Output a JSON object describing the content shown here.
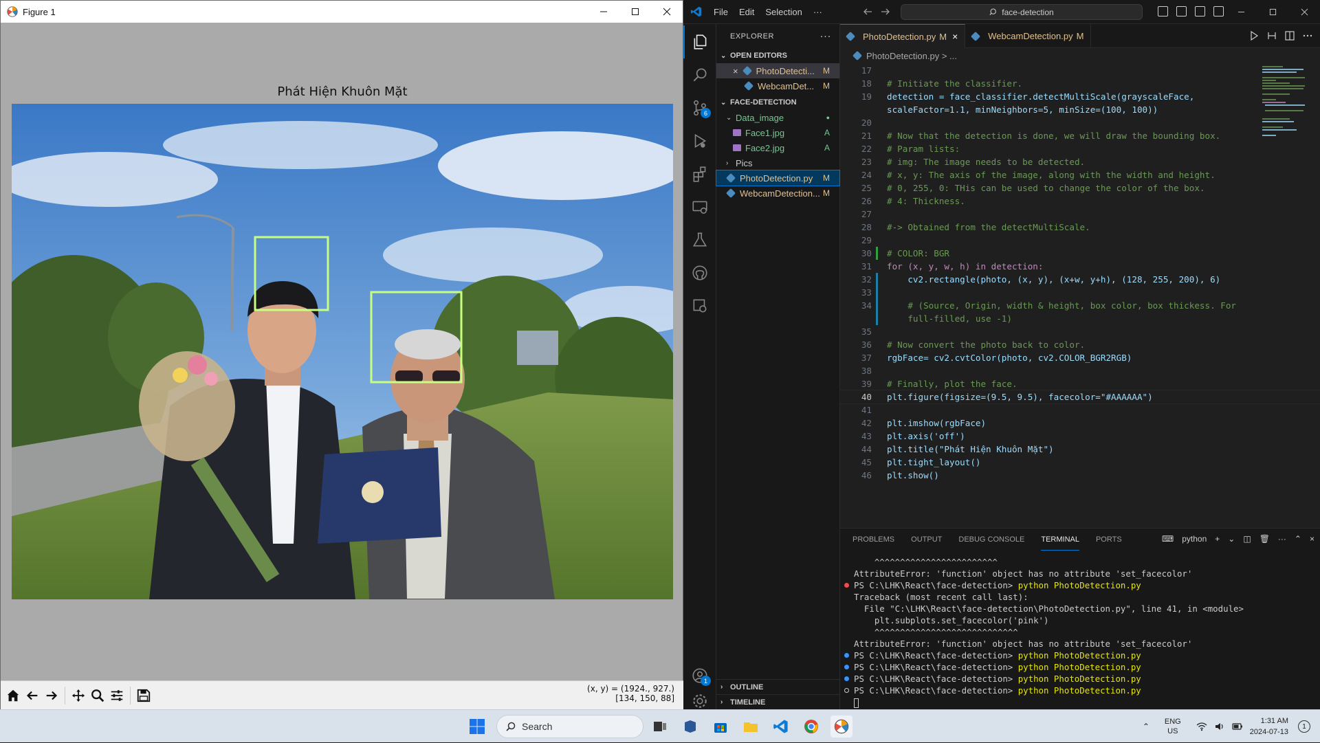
{
  "figure_window": {
    "title": "Figure 1",
    "plot_title": "Phát Hiện Khuôn Mặt",
    "facecolor": "#AAAAAA",
    "box_color": "#C8FF80",
    "coord_line1": "(x, y) = (1924., 927.)",
    "coord_line2": "[134, 150, 88]",
    "toolbar_icons": [
      "home-icon",
      "back-icon",
      "forward-icon",
      "pan-icon",
      "zoom-icon",
      "configure-icon",
      "save-icon"
    ]
  },
  "vscode": {
    "menu": [
      "File",
      "Edit",
      "Selection",
      "···"
    ],
    "search_text": "face-detection",
    "explorer_title": "EXPLORER",
    "open_editors_label": "OPEN EDITORS",
    "open_editors": [
      {
        "name": "PhotoDetecti...",
        "status": "M"
      },
      {
        "name": "WebcamDet...",
        "status": "M"
      }
    ],
    "folder_label": "FACE-DETECTION",
    "tree": [
      {
        "name": "Data_image",
        "status": "●"
      },
      {
        "name": "Face1.jpg",
        "status": "A"
      },
      {
        "name": "Face2.jpg",
        "status": "A"
      },
      {
        "name": "Pics",
        "status": ""
      },
      {
        "name": "PhotoDetection.py",
        "status": "M"
      },
      {
        "name": "WebcamDetection...",
        "status": "M"
      }
    ],
    "outline_label": "OUTLINE",
    "timeline_label": "TIMELINE",
    "tabs": [
      {
        "name": "PhotoDetection.py",
        "status": "M",
        "close": "×"
      },
      {
        "name": "WebcamDetection.py",
        "status": "M"
      }
    ],
    "breadcrumb": "PhotoDetection.py > ...",
    "badges": {
      "source_control": "6",
      "accounts": "1",
      "manage": "1"
    },
    "code": [
      {
        "n": "17",
        "t": ""
      },
      {
        "n": "18",
        "t": "# Initiate the classifier."
      },
      {
        "n": "19",
        "t": "detection = face_classifier.detectMultiScale(grayscaleFace,"
      },
      {
        "n": "",
        "t": "scaleFactor=1.1, minNeighbors=5, minSize=(100, 100))"
      },
      {
        "n": "20",
        "t": ""
      },
      {
        "n": "21",
        "t": "# Now that the detection is done, we will draw the bounding box."
      },
      {
        "n": "22",
        "t": "# Param lists:"
      },
      {
        "n": "23",
        "t": "# img: The image needs to be detected."
      },
      {
        "n": "24",
        "t": "# x, y: The axis of the image, along with the width and height."
      },
      {
        "n": "25",
        "t": "# 0, 255, 0: THis can be used to change the color of the box."
      },
      {
        "n": "26",
        "t": "# 4: Thickness."
      },
      {
        "n": "27",
        "t": ""
      },
      {
        "n": "28",
        "t": "#-> Obtained from the detectMultiScale."
      },
      {
        "n": "29",
        "t": ""
      },
      {
        "n": "30",
        "t": "# COLOR: BGR"
      },
      {
        "n": "31",
        "t": "for (x, y, w, h) in detection:"
      },
      {
        "n": "32",
        "t": "    cv2.rectangle(photo, (x, y), (x+w, y+h), (128, 255, 200), 6)"
      },
      {
        "n": "33",
        "t": ""
      },
      {
        "n": "34",
        "t": "    # (Source, Origin, width & height, box color, box thickess. For"
      },
      {
        "n": "",
        "t": "    full-filled, use -1)"
      },
      {
        "n": "35",
        "t": ""
      },
      {
        "n": "36",
        "t": "# Now convert the photo back to color."
      },
      {
        "n": "37",
        "t": "rgbFace= cv2.cvtColor(photo, cv2.COLOR_BGR2RGB)"
      },
      {
        "n": "38",
        "t": ""
      },
      {
        "n": "39",
        "t": "# Finally, plot the face."
      },
      {
        "n": "40",
        "t": "plt.figure(figsize=(9.5, 9.5), facecolor=\"#AAAAAA\")"
      },
      {
        "n": "41",
        "t": ""
      },
      {
        "n": "42",
        "t": "plt.imshow(rgbFace)"
      },
      {
        "n": "43",
        "t": "plt.axis('off')"
      },
      {
        "n": "44",
        "t": "plt.title(\"Phát Hiện Khuôn Mặt\")"
      },
      {
        "n": "45",
        "t": "plt.tight_layout()"
      },
      {
        "n": "46",
        "t": "plt.show()"
      }
    ],
    "panel_tabs": [
      "PROBLEMS",
      "OUTPUT",
      "DEBUG CONSOLE",
      "TERMINAL",
      "PORTS"
    ],
    "terminal_name": "python",
    "terminal": [
      {
        "dot": "",
        "text": "    ^^^^^^^^^^^^^^^^^^^^^^^^",
        "cmd": ""
      },
      {
        "dot": "",
        "text": "AttributeError: 'function' object has no attribute 'set_facecolor'",
        "cmd": ""
      },
      {
        "dot": "red",
        "text": "PS C:\\LHK\\React\\face-detection> ",
        "cmd": "python PhotoDetection.py"
      },
      {
        "dot": "",
        "text": "Traceback (most recent call last):",
        "cmd": ""
      },
      {
        "dot": "",
        "text": "  File \"C:\\LHK\\React\\face-detection\\PhotoDetection.py\", line 41, in <module>",
        "cmd": ""
      },
      {
        "dot": "",
        "text": "    plt.subplots.set_facecolor('pink')",
        "cmd": ""
      },
      {
        "dot": "",
        "text": "    ^^^^^^^^^^^^^^^^^^^^^^^^^^^^",
        "cmd": ""
      },
      {
        "dot": "",
        "text": "AttributeError: 'function' object has no attribute 'set_facecolor'",
        "cmd": ""
      },
      {
        "dot": "blue",
        "text": "PS C:\\LHK\\React\\face-detection> ",
        "cmd": "python PhotoDetection.py"
      },
      {
        "dot": "blue",
        "text": "PS C:\\LHK\\React\\face-detection> ",
        "cmd": "python PhotoDetection.py"
      },
      {
        "dot": "blue",
        "text": "PS C:\\LHK\\React\\face-detection> ",
        "cmd": "python PhotoDetection.py"
      },
      {
        "dot": "hollow",
        "text": "PS C:\\LHK\\React\\face-detection> ",
        "cmd": "python PhotoDetection.py"
      }
    ]
  },
  "taskbar": {
    "search_placeholder": "Search",
    "lang_line1": "ENG",
    "lang_line2": "US",
    "time": "1:31 AM",
    "date": "2024-07-13",
    "notifications": "1"
  }
}
